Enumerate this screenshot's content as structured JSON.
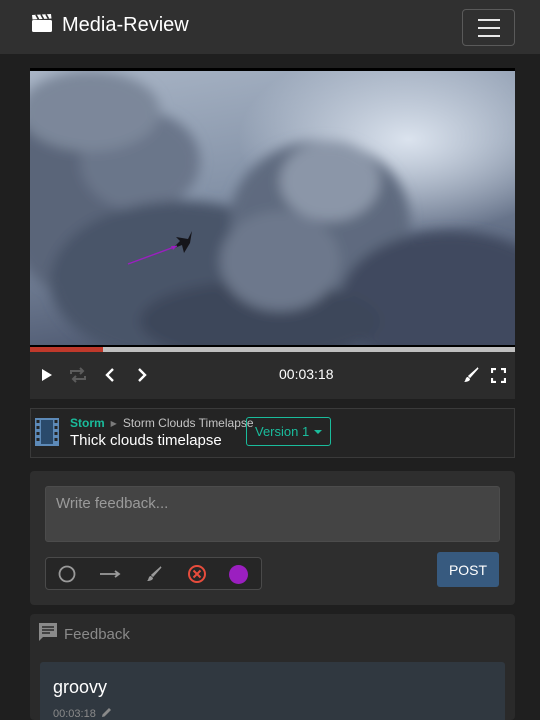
{
  "app": {
    "title": "Media-Review",
    "logo_icon": "clapperboard-icon",
    "menu_icon": "hamburger-menu-icon"
  },
  "player": {
    "timecode": "00:03:18",
    "progress_fraction": 0.15,
    "scrub_marker_fraction": 0.15,
    "controls": [
      "play-icon",
      "loop-icon",
      "prev-frame-icon",
      "next-frame-icon",
      "draw-icon",
      "fullscreen-icon"
    ]
  },
  "media": {
    "project": "Storm",
    "media_name": "Storm Clouds Timelapse",
    "title": "Thick clouds timelapse",
    "version_label": "Version 1"
  },
  "feedback_form": {
    "placeholder": "Write feedback...",
    "tools": [
      "circle-tool-icon",
      "arrow-tool-icon",
      "brush-tool-icon",
      "clear-drawing-icon",
      "color-swatch"
    ],
    "swatch_color": "#9b1fc0",
    "post_label": "POST"
  },
  "feedback": {
    "header": "Feedback",
    "comments": [
      {
        "text": "groovy",
        "timecode": "00:03:18"
      }
    ]
  },
  "colors": {
    "accent": "#1abc9c",
    "progress": "#c0392b",
    "marker": "#3498db",
    "post_button": "#375a7f"
  }
}
